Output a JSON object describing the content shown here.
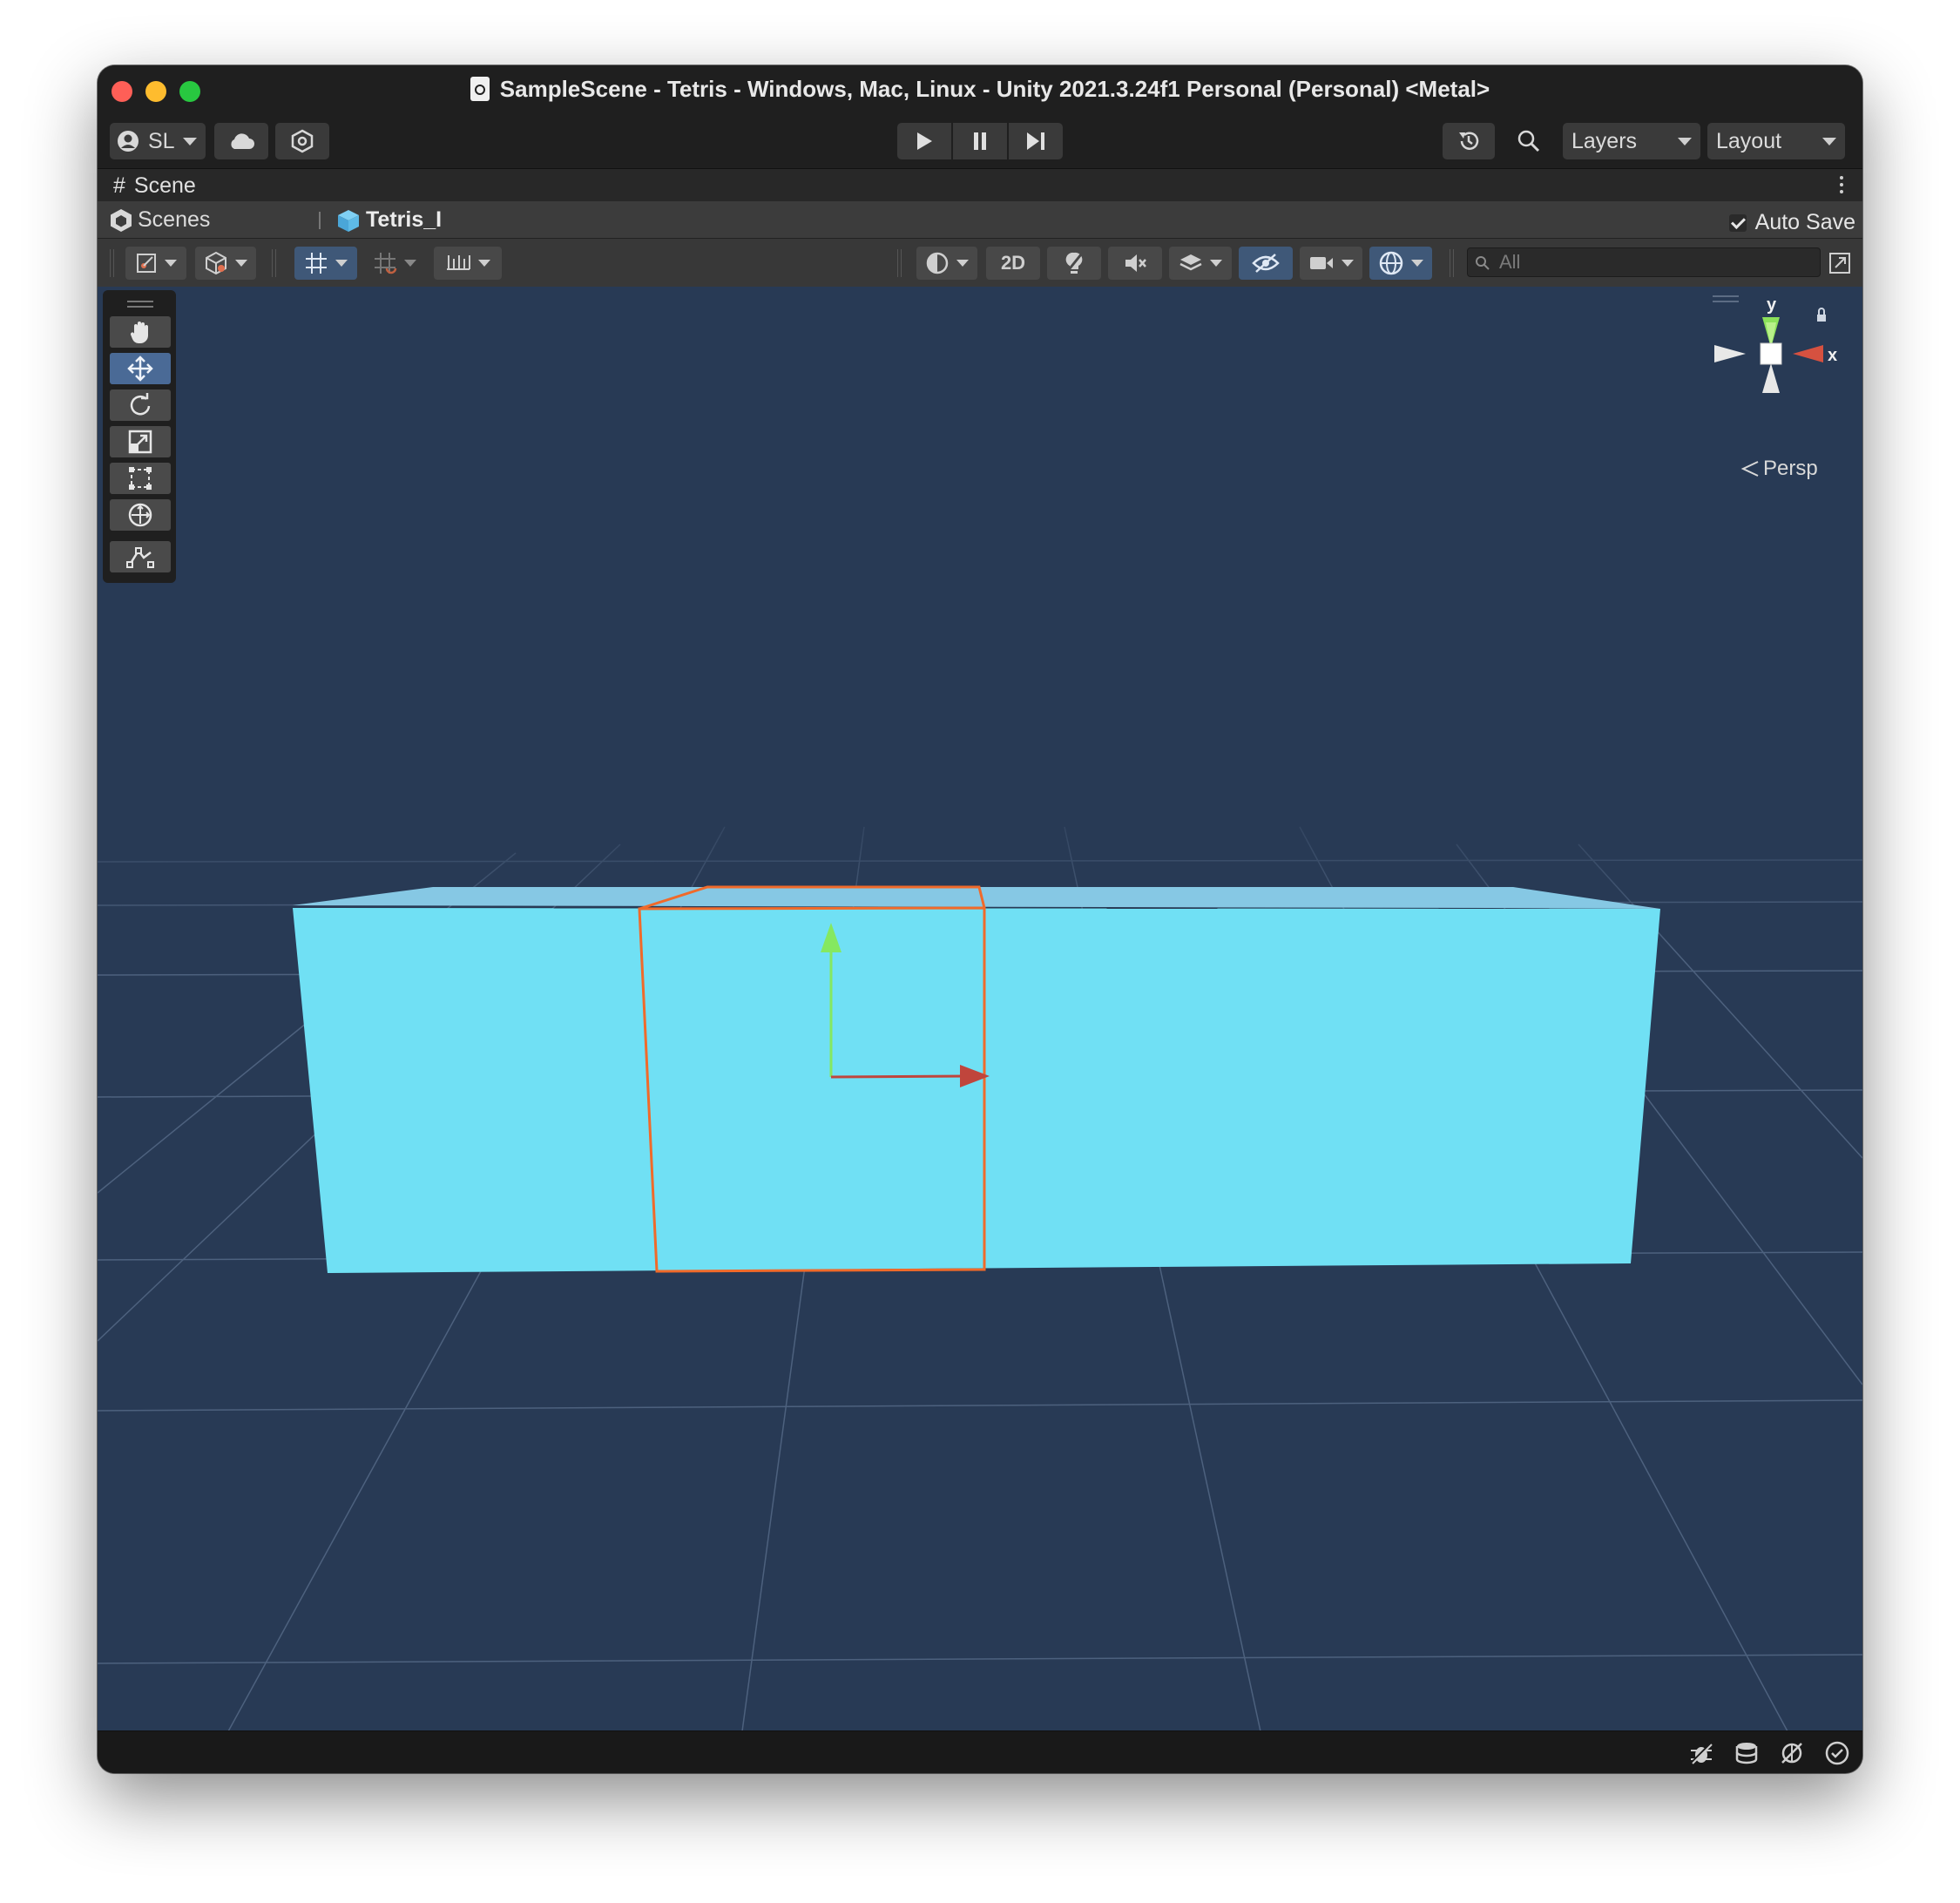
{
  "window": {
    "title": "SampleScene - Tetris - Windows, Mac, Linux - Unity 2021.3.24f1 Personal (Personal) <Metal>"
  },
  "toolbar": {
    "account_label": "SL",
    "layers_label": "Layers",
    "layout_label": "Layout"
  },
  "scene_tab": {
    "label": "Scene"
  },
  "breadcrumb": {
    "items": [
      "Scenes",
      "Tetris_I"
    ],
    "auto_save_label": "Auto Save",
    "auto_save_checked": true
  },
  "scene_toolbar": {
    "mode_2d_label": "2D",
    "search_placeholder": "All"
  },
  "viewport": {
    "projection_label": "Persp",
    "axis_labels": {
      "x": "x",
      "y": "y"
    },
    "object_color": "#70e0f4",
    "selection_color": "#f06a2a",
    "background_color": "#283a55"
  },
  "tools": [
    "hand",
    "move",
    "rotate",
    "scale",
    "rect",
    "transform",
    "custom"
  ],
  "active_tool": "move"
}
